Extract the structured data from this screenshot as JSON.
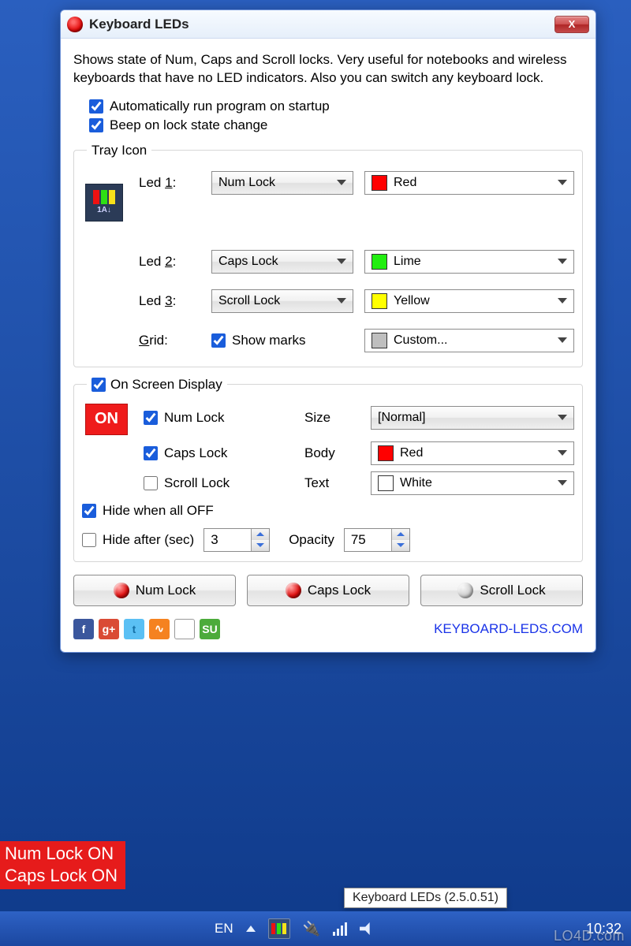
{
  "window": {
    "title": "Keyboard LEDs",
    "description": "Shows state of Num, Caps and Scroll locks. Very useful for notebooks and wireless keyboards that have no LED indicators. Also you can switch any keyboard lock.",
    "autorun_label": "Automatically run program on startup",
    "beep_label": "Beep on lock state change"
  },
  "tray": {
    "legend": "Tray Icon",
    "rows": [
      {
        "label_pre": "Led ",
        "label_u": "1",
        "label_post": ":",
        "value": "Num Lock",
        "color_name": "Red",
        "swatch": "#ff0000"
      },
      {
        "label_pre": "Led ",
        "label_u": "2",
        "label_post": ":",
        "value": "Caps Lock",
        "color_name": "Lime",
        "swatch": "#22ee11"
      },
      {
        "label_pre": "Led ",
        "label_u": "3",
        "label_post": ":",
        "value": "Scroll Lock",
        "color_name": "Yellow",
        "swatch": "#ffff00"
      }
    ],
    "grid_label_pre": "",
    "grid_label_u": "G",
    "grid_label_post": "rid:",
    "showmarks_label": "Show marks",
    "grid_color_name": "Custom...",
    "grid_swatch": "#bfbfbf",
    "icon_caption": "1A↓"
  },
  "osd": {
    "legend": "On Screen Display",
    "preview": "ON",
    "num_label": "Num Lock",
    "caps_label": "Caps Lock",
    "scroll_label": "Scroll Lock",
    "hideoff_label": "Hide when all OFF",
    "hideafter_label": "Hide after (sec)",
    "hideafter_value": "3",
    "opacity_label": "Opacity",
    "opacity_value": "75",
    "size_label": "Size",
    "size_value": "[Normal]",
    "body_label": "Body",
    "body_value": "Red",
    "body_swatch": "#ff0000",
    "text_label": "Text",
    "text_value": "White",
    "text_swatch": "#ffffff"
  },
  "buttons": {
    "num": "Num Lock",
    "caps": "Caps Lock",
    "scroll": "Scroll Lock"
  },
  "footer": {
    "link": "KEYBOARD-LEDS.COM"
  },
  "overlay": {
    "line1": "Num Lock ON",
    "line2": "Caps Lock ON"
  },
  "tooltip": "Keyboard LEDs (2.5.0.51)",
  "taskbar": {
    "lang": "EN",
    "clock": "10:32"
  },
  "watermark": "LO4D.com",
  "social": {
    "fb": "f",
    "gp": "g+",
    "tw": "t",
    "rss": "∿",
    "su": "SU"
  }
}
